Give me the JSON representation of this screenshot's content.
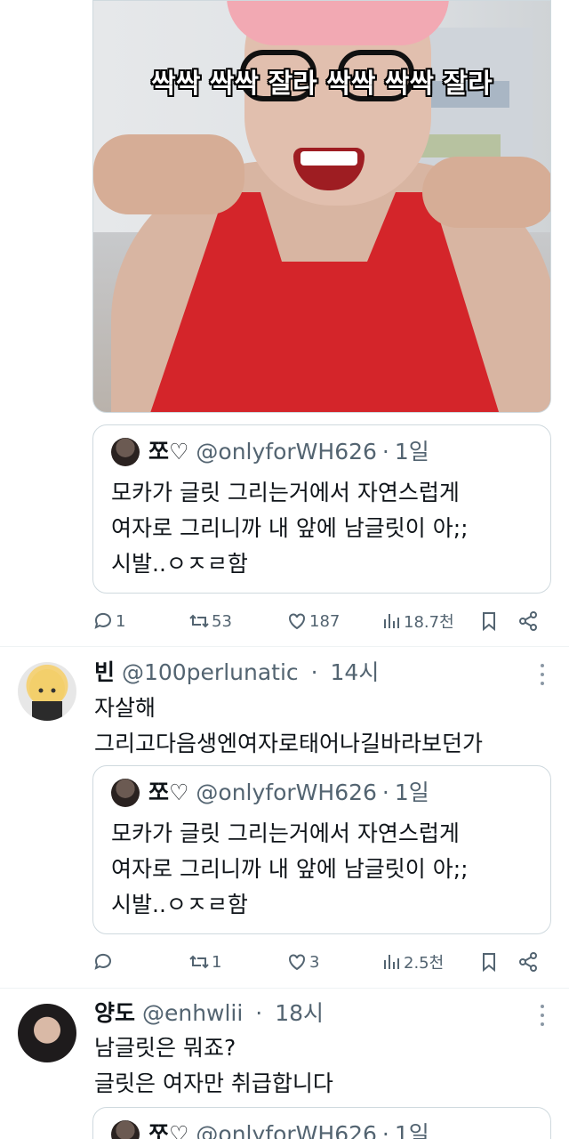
{
  "media": {
    "caption": "싹싹 싹싹 잘라 싹싹 싹싹 잘라"
  },
  "quoted_tweet": {
    "name": "쪼♡",
    "handle": "@onlyforWH626",
    "separator": "·",
    "time": "1일",
    "lines": [
      "모카가 글릿 그리는거에서 자연스럽게",
      "여자로 그리니까 내 앞에 남글릿이 아;;",
      "시발..ㅇㅈㄹ함"
    ]
  },
  "tweet_1_actions": {
    "replies": "1",
    "retweets": "53",
    "likes": "187",
    "views": "18.7천"
  },
  "tweet_2": {
    "name": "빈",
    "handle": "@100perlunatic",
    "separator": "·",
    "time": "14시",
    "lines": [
      "자살해",
      "그리고다음생엔여자로태어나길바라보던가"
    ],
    "actions": {
      "replies": "",
      "retweets": "1",
      "likes": "3",
      "views": "2.5천"
    }
  },
  "tweet_3": {
    "name": "양도",
    "handle": "@enhwlii",
    "separator": "·",
    "time": "18시",
    "lines": [
      "남글릿은 뭐죠?",
      "글릿은 여자만 취급합니다"
    ]
  },
  "colors": {
    "text": "#0f1419",
    "secondary": "#536471",
    "border": "#cfd9de",
    "tank_top": "#d4252a",
    "hat": "#f2a9b3"
  },
  "icons": [
    "reply-icon",
    "retweet-icon",
    "like-icon",
    "views-icon",
    "bookmark-icon",
    "share-icon",
    "more-icon"
  ]
}
